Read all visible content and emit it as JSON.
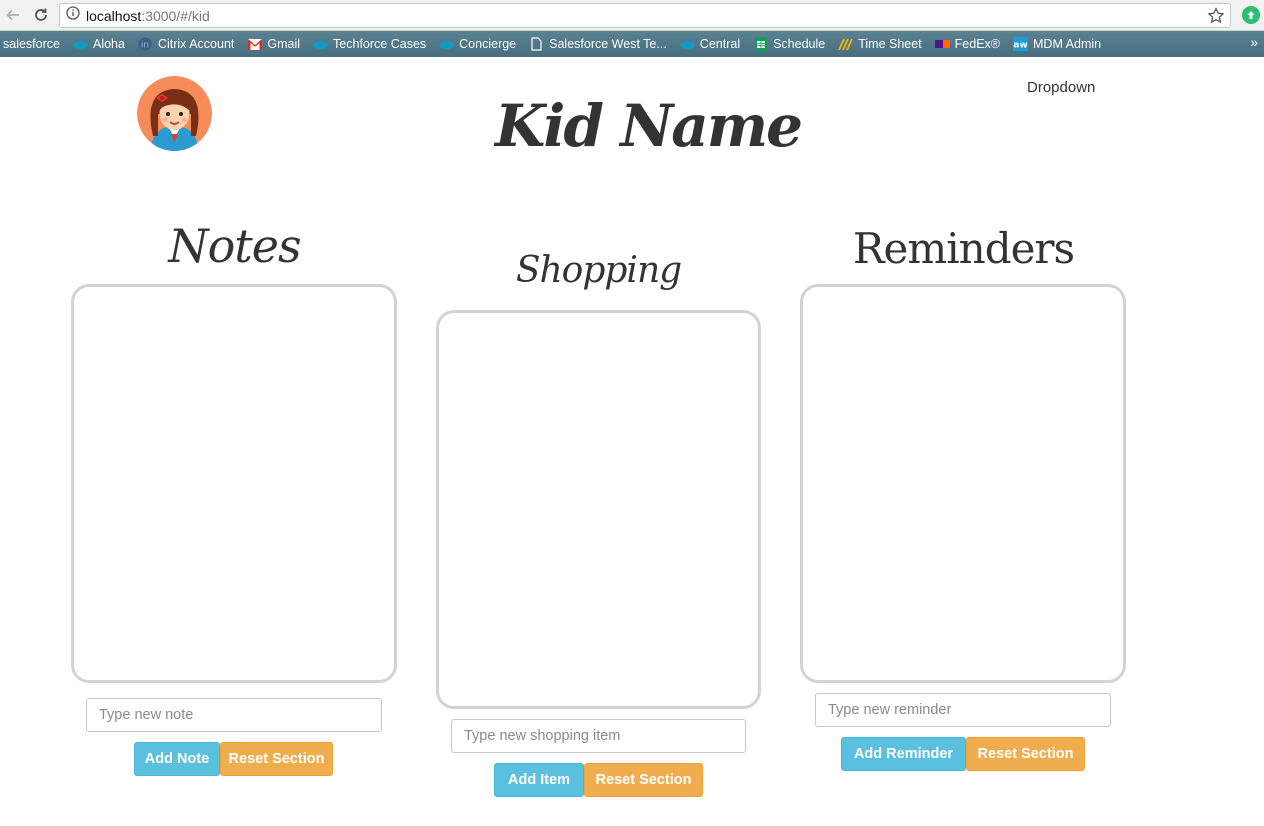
{
  "browser": {
    "url_host": "localhost",
    "url_path": ":3000/#/kid",
    "bookmarks": [
      {
        "label": "salesforce",
        "icon": "none"
      },
      {
        "label": "Aloha",
        "icon": "salesforce-cloud-icon"
      },
      {
        "label": "Citrix Account",
        "icon": "citrix-icon"
      },
      {
        "label": "Gmail",
        "icon": "gmail-icon"
      },
      {
        "label": "Techforce Cases",
        "icon": "salesforce-cloud-icon"
      },
      {
        "label": "Concierge",
        "icon": "salesforce-cloud-icon"
      },
      {
        "label": "Salesforce West Te...",
        "icon": "page-icon"
      },
      {
        "label": "Central",
        "icon": "salesforce-cloud-icon"
      },
      {
        "label": "Schedule",
        "icon": "sheets-icon"
      },
      {
        "label": "Time Sheet",
        "icon": "timesheet-icon"
      },
      {
        "label": "FedEx®",
        "icon": "fedex-icon"
      },
      {
        "label": "MDM Admin",
        "icon": "aw-icon"
      }
    ],
    "more": "»"
  },
  "header": {
    "kid_name": "Kid Name",
    "dropdown_label": "Dropdown"
  },
  "sections": {
    "notes": {
      "title": "Notes",
      "placeholder": "Type new note",
      "add_label": "Add Note",
      "reset_label": "Reset Section"
    },
    "shopping": {
      "title": "Shopping",
      "placeholder": "Type new shopping item",
      "add_label": "Add Item",
      "reset_label": "Reset Section"
    },
    "reminders": {
      "title": "Reminders",
      "placeholder": "Type new reminder",
      "add_label": "Add Reminder",
      "reset_label": "Reset Section"
    }
  },
  "colors": {
    "info": "#5bc0de",
    "warning": "#f0ad4e",
    "box_border": "#d3d3d3",
    "bookmark_bar": "#4d7585"
  }
}
